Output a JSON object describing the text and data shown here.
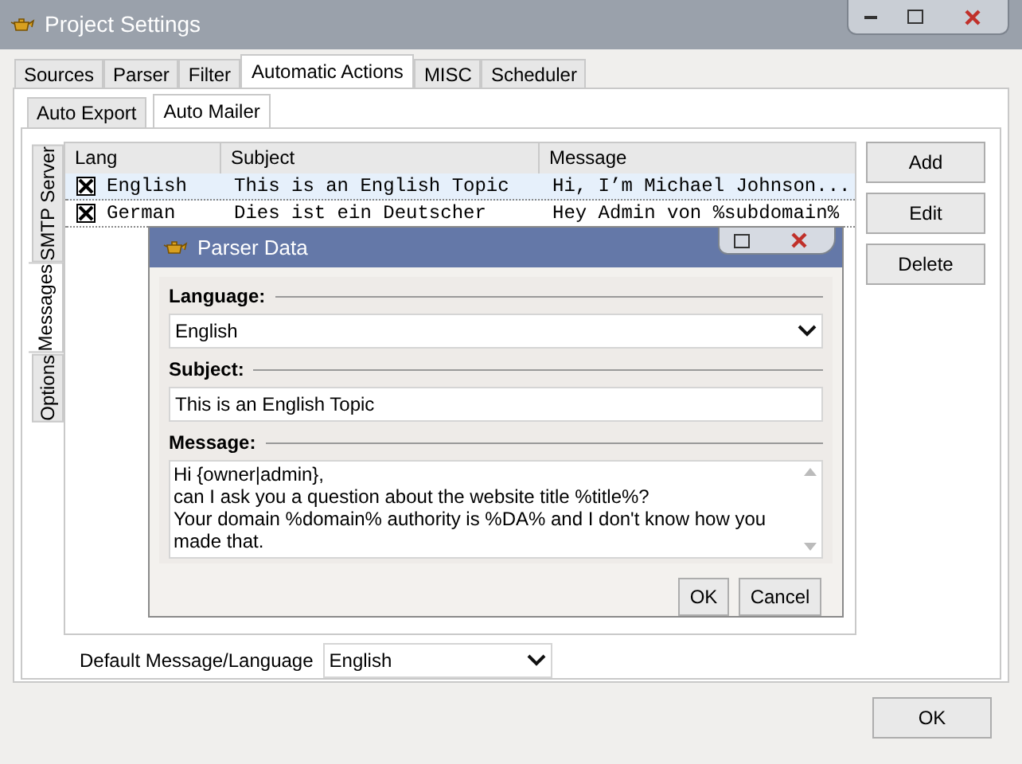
{
  "window": {
    "title": "Project Settings"
  },
  "tabs": [
    {
      "label": "Sources",
      "selected": false
    },
    {
      "label": "Parser",
      "selected": false
    },
    {
      "label": "Filter",
      "selected": false
    },
    {
      "label": "Automatic Actions",
      "selected": true
    },
    {
      "label": "MISC",
      "selected": false
    },
    {
      "label": "Scheduler",
      "selected": false
    }
  ],
  "subtabs": [
    {
      "label": "Auto Export",
      "selected": false
    },
    {
      "label": "Auto Mailer",
      "selected": true
    }
  ],
  "side_tabs": [
    {
      "label": "SMTP Server",
      "selected": false
    },
    {
      "label": "Messages",
      "selected": true
    },
    {
      "label": "Options",
      "selected": false
    }
  ],
  "table": {
    "columns": [
      "Lang",
      "Subject",
      "Message"
    ],
    "rows": [
      {
        "checked": true,
        "selected": true,
        "cells": [
          "English",
          "This is an English Topic",
          "Hi, I’m Michael Johnson..."
        ]
      },
      {
        "checked": true,
        "selected": false,
        "cells": [
          "German",
          "Dies ist ein Deutscher",
          "Hey Admin von %subdomain%"
        ]
      }
    ]
  },
  "side_buttons": [
    "Add",
    "Edit",
    "Delete"
  ],
  "default_message": {
    "label": "Default Message/Language",
    "value": "English"
  },
  "dialog": {
    "title": "Parser Data",
    "language": {
      "label": "Language:",
      "value": "English"
    },
    "subject": {
      "label": "Subject:",
      "value": "This is an English Topic"
    },
    "message": {
      "label": "Message:",
      "value": "Hi {owner|admin},\ncan I ask you a question about the website title %title%?\nYour domain %domain% authority is %DA% and I don't know how you made that."
    },
    "buttons": [
      "OK",
      "Cancel"
    ]
  },
  "ok_button": "OK"
}
